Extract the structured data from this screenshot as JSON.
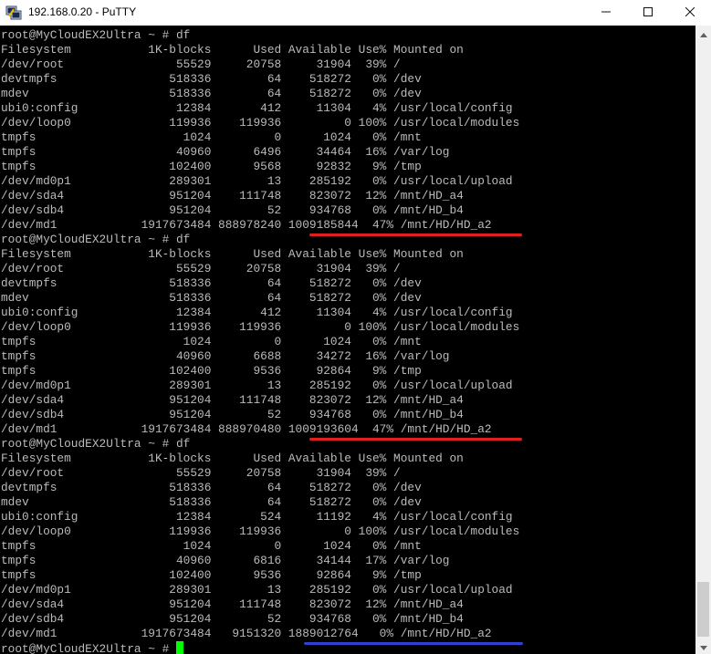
{
  "window": {
    "title": "192.168.0.20 - PuTTY",
    "icon": "putty-icon",
    "controls": [
      "minimize-icon",
      "maximize-icon",
      "close-icon"
    ]
  },
  "terminal": {
    "lines": [
      "root@MyCloudEX2Ultra ~ # df",
      "Filesystem           1K-blocks      Used Available Use% Mounted on",
      "/dev/root                55529     20758     31904  39% /",
      "devtmpfs                518336        64    518272   0% /dev",
      "mdev                    518336        64    518272   0% /dev",
      "ubi0:config              12384       412     11304   4% /usr/local/config",
      "/dev/loop0              119936    119936         0 100% /usr/local/modules",
      "tmpfs                     1024         0      1024   0% /mnt",
      "tmpfs                    40960      6496     34464  16% /var/log",
      "tmpfs                   102400      9568     92832   9% /tmp",
      "/dev/md0p1              289301        13    285192   0% /usr/local/upload",
      "/dev/sda4               951204    111748    823072  12% /mnt/HD_a4",
      "/dev/sdb4               951204        52    934768   0% /mnt/HD_b4",
      "/dev/md1            1917673484 888978240 1009185844  47% /mnt/HD/HD_a2",
      "root@MyCloudEX2Ultra ~ # df",
      "Filesystem           1K-blocks      Used Available Use% Mounted on",
      "/dev/root                55529     20758     31904  39% /",
      "devtmpfs                518336        64    518272   0% /dev",
      "mdev                    518336        64    518272   0% /dev",
      "ubi0:config              12384       412     11304   4% /usr/local/config",
      "/dev/loop0              119936    119936         0 100% /usr/local/modules",
      "tmpfs                     1024         0      1024   0% /mnt",
      "tmpfs                    40960      6688     34272  16% /var/log",
      "tmpfs                   102400      9536     92864   9% /tmp",
      "/dev/md0p1              289301        13    285192   0% /usr/local/upload",
      "/dev/sda4               951204    111748    823072  12% /mnt/HD_a4",
      "/dev/sdb4               951204        52    934768   0% /mnt/HD_b4",
      "/dev/md1            1917673484 888970480 1009193604  47% /mnt/HD/HD_a2",
      "root@MyCloudEX2Ultra ~ # df",
      "Filesystem           1K-blocks      Used Available Use% Mounted on",
      "/dev/root                55529     20758     31904  39% /",
      "devtmpfs                518336        64    518272   0% /dev",
      "mdev                    518336        64    518272   0% /dev",
      "ubi0:config              12384       524     11192   4% /usr/local/config",
      "/dev/loop0              119936    119936         0 100% /usr/local/modules",
      "tmpfs                     1024         0      1024   0% /mnt",
      "tmpfs                    40960      6816     34144  17% /var/log",
      "tmpfs                   102400      9536     92864   9% /tmp",
      "/dev/md0p1              289301        13    285192   0% /usr/local/upload",
      "/dev/sda4               951204    111748    823072  12% /mnt/HD_a4",
      "/dev/sdb4               951204        52    934768   0% /mnt/HD_b4",
      "/dev/md1            1917673484   9151320 1889012764   0% /mnt/HD/HD_a2"
    ],
    "prompt": "root@MyCloudEX2Ultra ~ # ",
    "cursor_color": "#00ff00",
    "text_color": "#bbbbbb",
    "background": "#000000"
  },
  "annotations": [
    {
      "color": "#e02020"
    },
    {
      "color": "#e02020"
    },
    {
      "color": "#3040d0"
    }
  ],
  "scrollbar": {
    "icons": [
      "scroll-up-icon",
      "scroll-down-icon"
    ]
  }
}
